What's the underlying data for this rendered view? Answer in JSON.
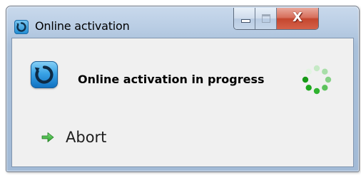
{
  "window": {
    "title": "Online activation",
    "app_icon": "activation-icon",
    "caption_buttons": {
      "minimize_icon": "minimize-icon",
      "maximize_icon": "maximize-icon",
      "close_glyph": "X"
    }
  },
  "content": {
    "status_icon": "activation-icon",
    "status_text": "Online activation in progress",
    "spinner_icon": "loading-spinner-icon",
    "abort": {
      "icon": "green-arrow-right-icon",
      "label": "Abort"
    }
  },
  "colors": {
    "accent_blue": "#1f8bd2",
    "spinner_green": "#22b022",
    "arrow_green": "#3db83d",
    "close_red": "#c4462e"
  }
}
